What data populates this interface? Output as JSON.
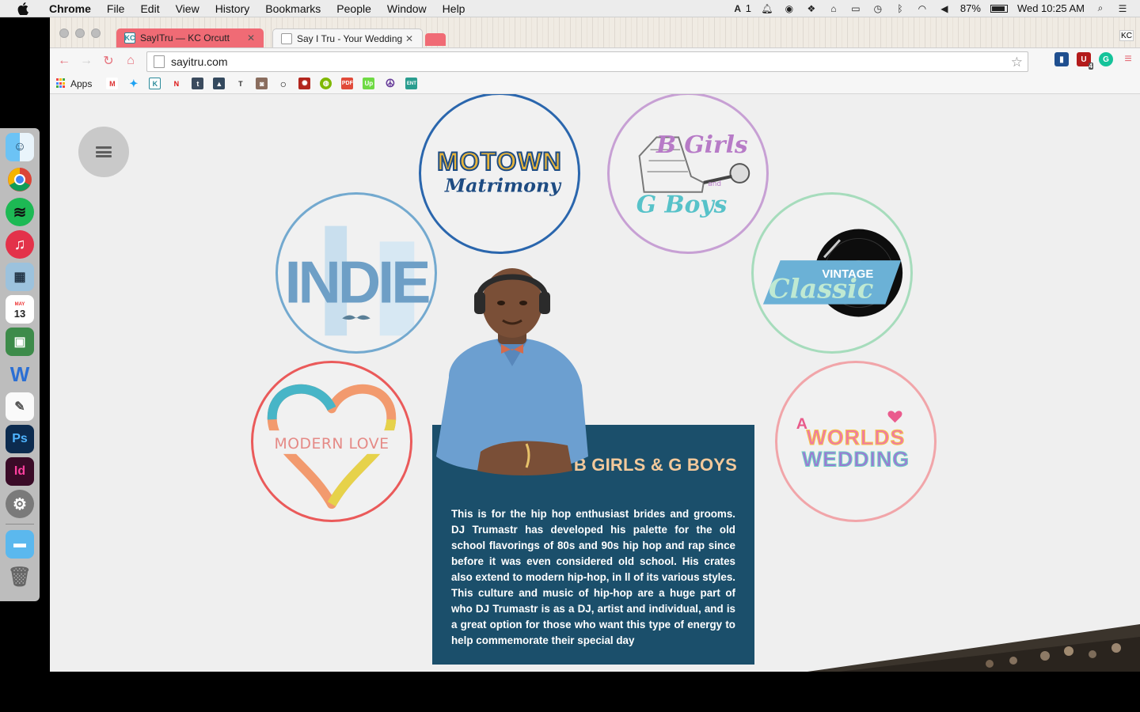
{
  "menubar": {
    "app": "Chrome",
    "items": [
      "File",
      "Edit",
      "View",
      "History",
      "Bookmarks",
      "People",
      "Window",
      "Help"
    ],
    "adobe_count": "1",
    "battery": "87%",
    "clock": "Wed 10:25 AM"
  },
  "browser": {
    "tabs": [
      {
        "title": "SayITru — KC Orcutt",
        "favicon": "KC"
      },
      {
        "title": "Say I Tru - Your Wedding M",
        "favicon": ""
      }
    ],
    "profile": "KC",
    "url": "sayitru.com",
    "bookmarks_apps_label": "Apps",
    "extension_badge": "4"
  },
  "page": {
    "circles": {
      "motown": {
        "line1": "MOTOWN",
        "line2": "Matrimony"
      },
      "bgirls": {
        "line1": "B Girls",
        "line2": "and",
        "line3": "G Boys"
      },
      "indie": {
        "text": "INDIE"
      },
      "vintage": {
        "line1": "VINTAGE",
        "line2": "Classic"
      },
      "modern": {
        "text": "MODERN LOVE"
      },
      "world": {
        "line1": "A",
        "line2": "WORLDS",
        "line3": "WEDDING"
      }
    },
    "panel": {
      "title": "B GIRLS & G BOYS",
      "body": "This is for the hip hop enthusiast brides and grooms. DJ Trumastr has developed his palette for the old school flavorings of 80s and 90s hip hop and rap since before it was even considered old school. His crates also extend to modern hip-hop, in ll of its various styles. This culture and music of hip-hop are a huge part of who DJ Trumastr is as a DJ, artist and individual, and is a great option for those who want this type of energy to help commemorate their special day"
    }
  },
  "dock": {
    "calendar_month": "MAY",
    "calendar_day": "13"
  },
  "colors": {
    "tab_accent": "#f06b75",
    "panel_bg": "#1b4f6b",
    "panel_title": "#f3c99b"
  }
}
